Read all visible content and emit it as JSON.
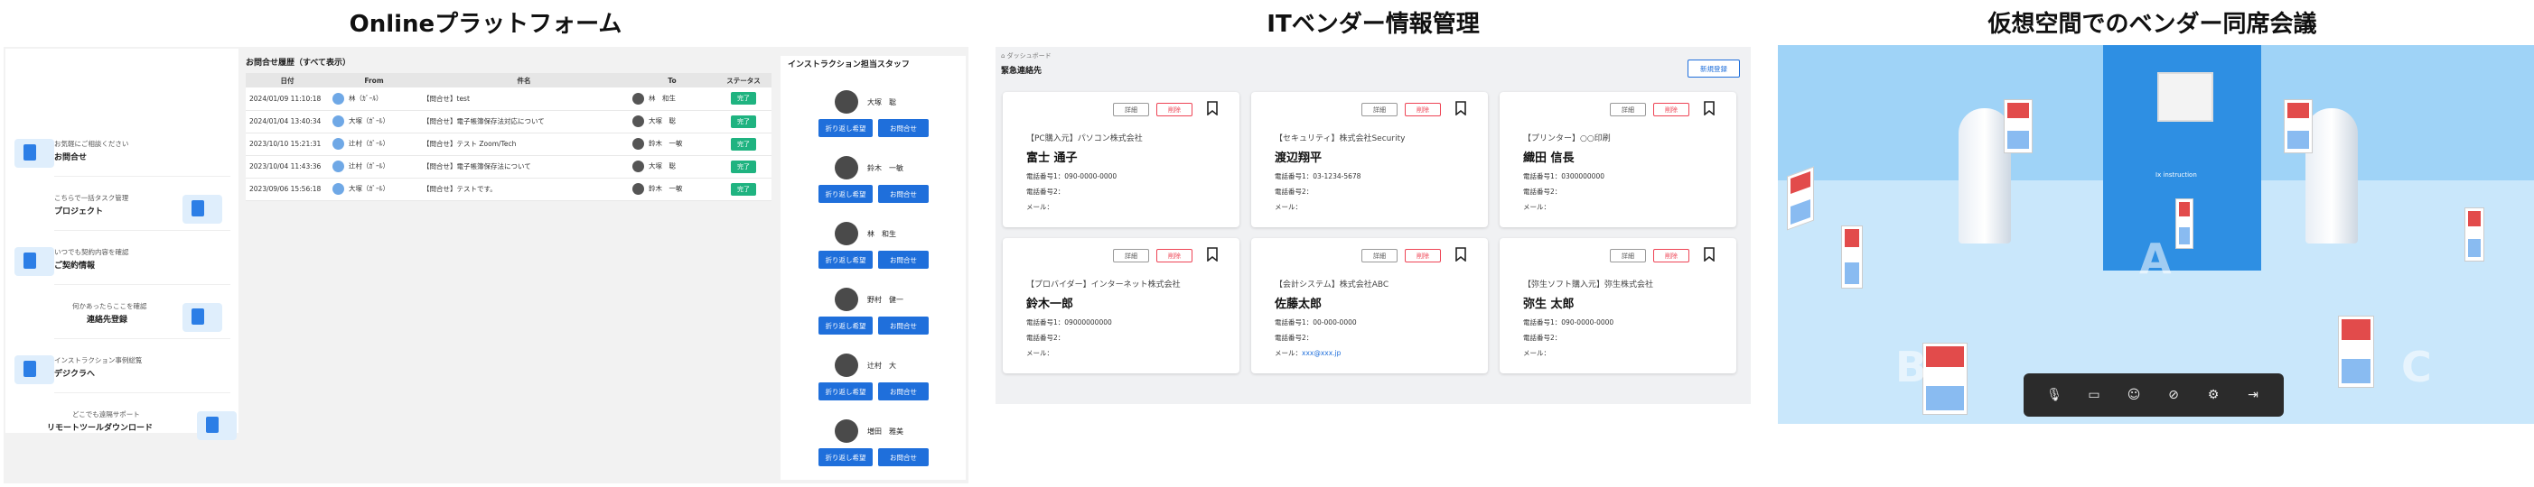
{
  "titles": {
    "online": "Onlineプラットフォーム",
    "vendor": "ITベンダー情報管理",
    "virtual": "仮想空間でのベンダー同席会議"
  },
  "sidebar": {
    "items": [
      {
        "sub": "お気軽にご相談ください",
        "main": "お問合せ",
        "icon": "inquiry-icon"
      },
      {
        "sub": "こちらで一括タスク管理",
        "main": "プロジェクト",
        "icon": "project-icon"
      },
      {
        "sub": "いつでも契約内容を確認",
        "main": "ご契約情報",
        "icon": "contract-icon"
      },
      {
        "sub": "何かあったらここを確認",
        "main": "連絡先登録",
        "icon": "contact-icon"
      },
      {
        "sub": "インストラクション事例総覧",
        "main": "デジクラへ",
        "icon": "digikura-icon"
      },
      {
        "sub": "どこでも遠隔サポート",
        "main": "リモートツールダウンロード",
        "icon": "remote-tool-icon"
      }
    ]
  },
  "inquiries": {
    "heading": "お問合せ履歴（すべて表示）",
    "columns": [
      "日付",
      "From",
      "件名",
      "To",
      "ステータス"
    ],
    "rows": [
      {
        "date": "2024/01/09 11:10:18",
        "from": "林（ｶﾞｰﾙ）",
        "subject": "【問合せ】test",
        "to": "林　和生",
        "status": "完了"
      },
      {
        "date": "2024/01/04 13:40:34",
        "from": "大塚（ｶﾞｰﾙ）",
        "subject": "【問合せ】電子帳簿保存法対応について",
        "to": "大塚　聡",
        "status": "完了"
      },
      {
        "date": "2023/10/10 15:21:31",
        "from": "辻村（ｶﾞｰﾙ）",
        "subject": "【問合せ】テスト Zoom/Tech",
        "to": "鈴木　一敏",
        "status": "完了"
      },
      {
        "date": "2023/10/04 11:43:36",
        "from": "辻村（ｶﾞｰﾙ）",
        "subject": "【問合せ】電子帳簿保存法について",
        "to": "大塚　聡",
        "status": "完了"
      },
      {
        "date": "2023/09/06 15:56:18",
        "from": "大塚（ｶﾞｰﾙ）",
        "subject": "【問合せ】テストです。",
        "to": "鈴木　一敏",
        "status": "完了"
      }
    ]
  },
  "staff": {
    "heading": "インストラクション担当スタッフ",
    "callback_label": "折り返し希望",
    "contact_label": "お問合せ",
    "members": [
      "大塚　聡",
      "鈴木　一敏",
      "林　和生",
      "野村　健一",
      "辻村　大",
      "増田　雅美"
    ]
  },
  "vendor": {
    "breadcrumb": "ダッシュボード",
    "title": "緊急連絡先",
    "new_label": "新規登録",
    "detail_label": "詳細",
    "delete_label": "削除",
    "cards": [
      {
        "category": "【PC購入元】パソコン株式会社",
        "person": "富士 通子",
        "tel1": "電話番号1：090-0000-0000",
        "tel2": "電話番号2：",
        "mail_label": "メール：",
        "mail": ""
      },
      {
        "category": "【セキュリティ】株式会社Security",
        "person": "渡辺翔平",
        "tel1": "電話番号1：03-1234-5678",
        "tel2": "電話番号2：",
        "mail_label": "メール：",
        "mail": ""
      },
      {
        "category": "【プリンター】○○印刷",
        "person": "織田 信長",
        "tel1": "電話番号1：0300000000",
        "tel2": "電話番号2：",
        "mail_label": "メール：",
        "mail": ""
      },
      {
        "category": "【プロバイダー】インターネット株式会社",
        "person": "鈴木一郎",
        "tel1": "電話番号1：09000000000",
        "tel2": "電話番号2：",
        "mail_label": "メール：",
        "mail": ""
      },
      {
        "category": "【会計システム】株式会社ABC",
        "person": "佐藤太郎",
        "tel1": "電話番号1：00-000-0000",
        "tel2": "電話番号2：",
        "mail_label": "メール：",
        "mail": "xxx@xxx.jp"
      },
      {
        "category": "【弥生ソフト購入元】弥生株式会社",
        "person": "弥生 太郎",
        "tel1": "電話番号1：090-0000-0000",
        "tel2": "電話番号2：",
        "mail_label": "メール：",
        "mail": ""
      }
    ]
  },
  "virtual": {
    "wall_text": "Ix instruction",
    "floor_letters": [
      "A",
      "B",
      "C"
    ],
    "controls": [
      "mic-off-icon",
      "camera-off-icon",
      "emoji-icon",
      "block-icon",
      "settings-icon",
      "exit-icon"
    ],
    "colors": {
      "floor": "#c9e7fb",
      "wall": "#2e8fe3",
      "bar": "#2b2b2b"
    }
  }
}
